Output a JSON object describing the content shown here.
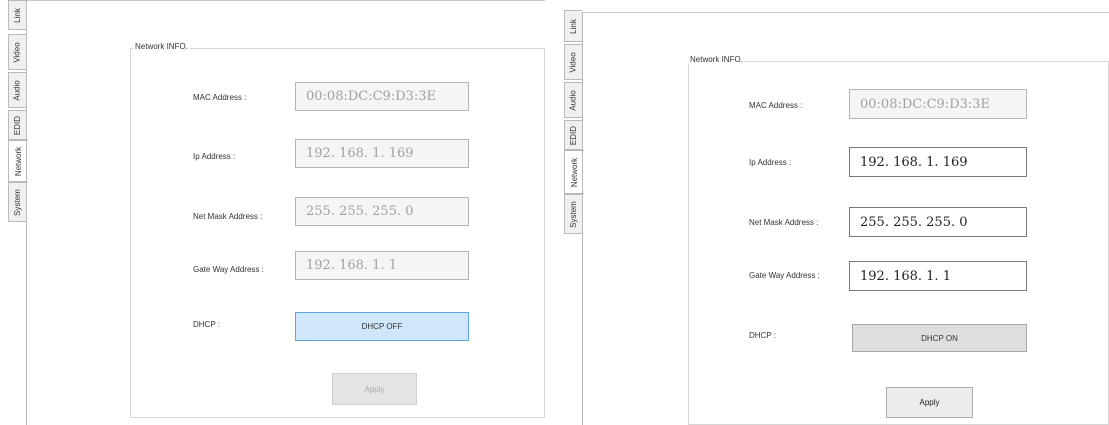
{
  "tabs": [
    "Link",
    "Video",
    "Audio",
    "EDID",
    "Network",
    "System"
  ],
  "active_tab": "Network",
  "group_title": "Network INFO.",
  "labels": {
    "mac": "MAC Address :",
    "ip": "Ip Address :",
    "mask": "Net Mask Address :",
    "gateway": "Gate Way Address :",
    "dhcp": "DHCP :"
  },
  "left": {
    "mac": "00:08:DC:C9:D3:3E",
    "ip": "192. 168. 1. 169",
    "mask": "255. 255. 255. 0",
    "gateway": "192. 168. 1. 1",
    "dhcp_button": "DHCP OFF",
    "apply_button": "Apply"
  },
  "right": {
    "mac": "00:08:DC:C9:D3:3E",
    "ip": "192. 168. 1. 169",
    "mask": "255. 255. 255. 0",
    "gateway": "192. 168. 1. 1",
    "dhcp_button": "DHCP ON",
    "apply_button": "Apply"
  }
}
